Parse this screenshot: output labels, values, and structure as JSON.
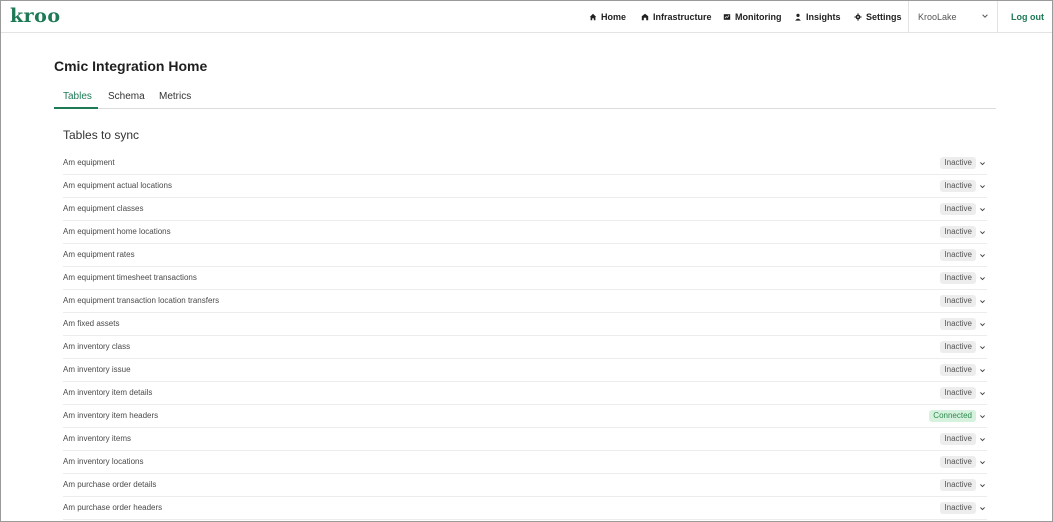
{
  "app": {
    "logo": "kroo"
  },
  "nav": {
    "items": [
      {
        "label": "Home",
        "icon": "home-icon"
      },
      {
        "label": "Infrastructure",
        "icon": "building-icon"
      },
      {
        "label": "Monitoring",
        "icon": "monitor-icon"
      },
      {
        "label": "Insights",
        "icon": "person-icon"
      },
      {
        "label": "Settings",
        "icon": "gear-icon"
      }
    ],
    "workspace": "KrooLake",
    "logout": "Log out"
  },
  "page": {
    "title": "Cmic Integration Home",
    "tabs": [
      {
        "label": "Tables",
        "active": true
      },
      {
        "label": "Schema",
        "active": false
      },
      {
        "label": "Metrics",
        "active": false
      }
    ],
    "section_title": "Tables to sync"
  },
  "tables": [
    {
      "name": "Am equipment",
      "status": "Inactive"
    },
    {
      "name": "Am equipment actual locations",
      "status": "Inactive"
    },
    {
      "name": "Am equipment classes",
      "status": "Inactive"
    },
    {
      "name": "Am equipment home locations",
      "status": "Inactive"
    },
    {
      "name": "Am equipment rates",
      "status": "Inactive"
    },
    {
      "name": "Am equipment timesheet transactions",
      "status": "Inactive"
    },
    {
      "name": "Am equipment transaction location transfers",
      "status": "Inactive"
    },
    {
      "name": "Am fixed assets",
      "status": "Inactive"
    },
    {
      "name": "Am inventory class",
      "status": "Inactive"
    },
    {
      "name": "Am inventory issue",
      "status": "Inactive"
    },
    {
      "name": "Am inventory item details",
      "status": "Inactive"
    },
    {
      "name": "Am inventory item headers",
      "status": "Connected"
    },
    {
      "name": "Am inventory items",
      "status": "Inactive"
    },
    {
      "name": "Am inventory locations",
      "status": "Inactive"
    },
    {
      "name": "Am purchase order details",
      "status": "Inactive"
    },
    {
      "name": "Am purchase order headers",
      "status": "Inactive"
    }
  ],
  "colors": {
    "brand": "#1e7a55",
    "connected_bg": "#d6f1dd",
    "connected_text": "#2d8a4e",
    "inactive_bg": "#ededed"
  }
}
